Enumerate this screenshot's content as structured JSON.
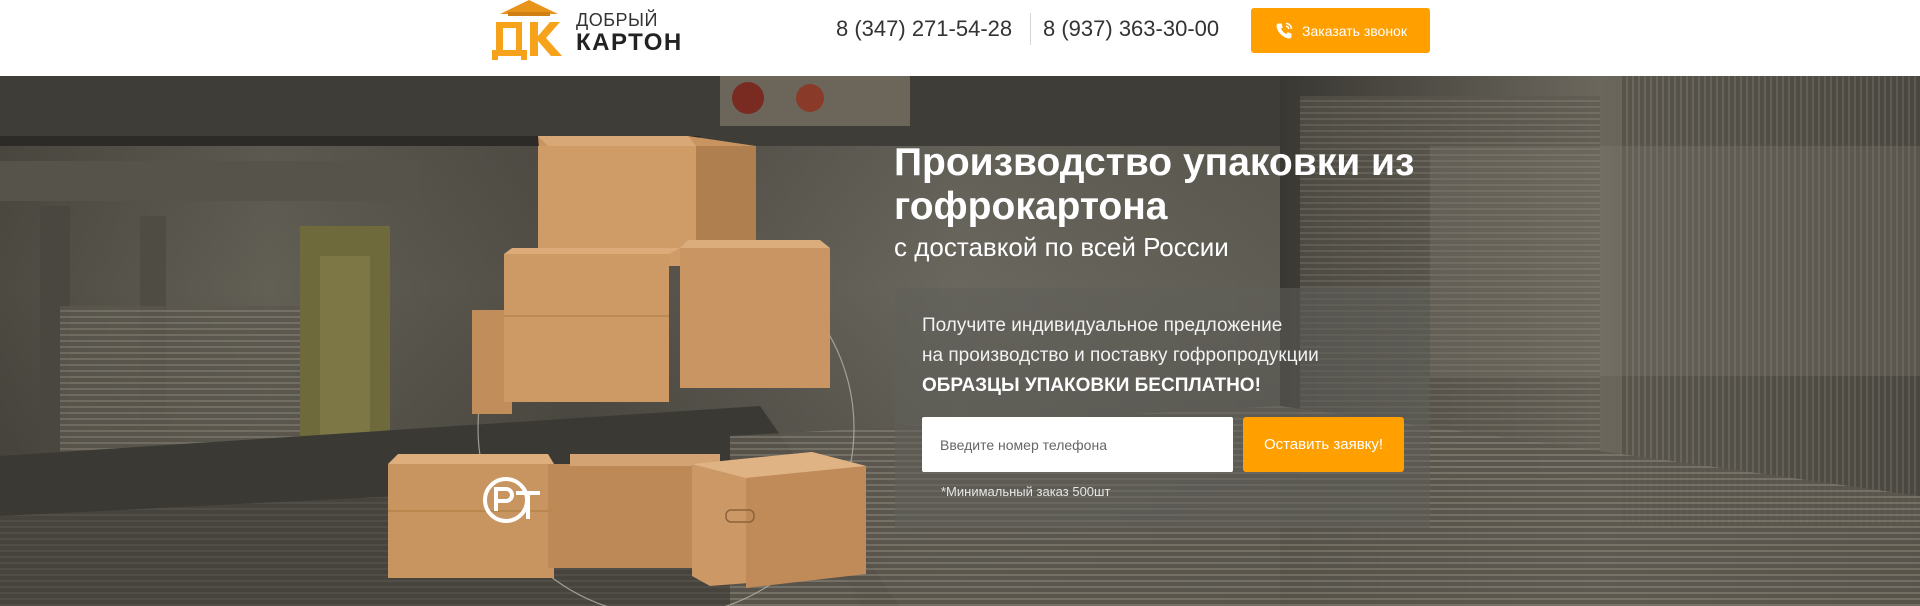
{
  "header": {
    "logo": {
      "line1": "ДОБРЫЙ",
      "line2": "КАРТОН",
      "mark_letters": "ДК",
      "mark_color": "#f7a21b"
    },
    "phones": [
      "8 (347) 271-54-28",
      "8 (937) 363-30-00"
    ],
    "call_button": {
      "label": "Заказать звонок",
      "icon": "phone-icon"
    }
  },
  "hero": {
    "title": "Производство упаковки из гофрокартона",
    "subtitle": "с доставкой по всей России",
    "offer": {
      "line1": "Получите индивидуальное предложение",
      "line2": "на производство и поставку гофропродукции",
      "line3": "ОБРАЗЦЫ УПАКОВКИ БЕСПЛАТНО!"
    },
    "form": {
      "phone_placeholder": "Введите номер телефона",
      "submit_label": "Оставить заявку!",
      "note": "*Минимальный заказ 500шт"
    },
    "certification_icon": "rst-certification-icon"
  },
  "colors": {
    "accent": "#ff9f00",
    "box": "#c89a66",
    "background": "#ffffff"
  }
}
